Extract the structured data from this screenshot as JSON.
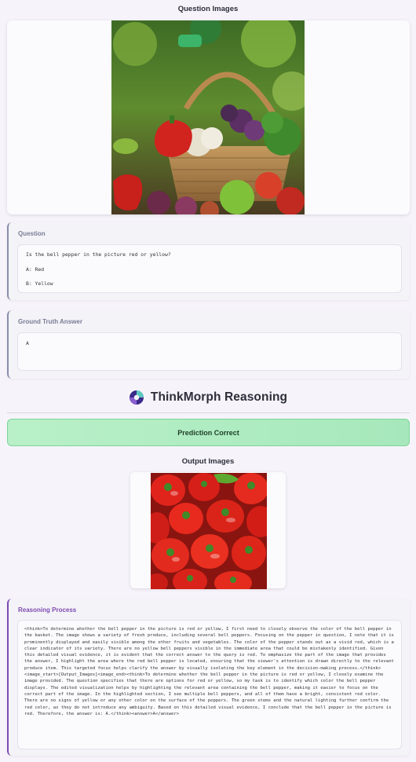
{
  "question_images": {
    "title": "Question Images"
  },
  "question": {
    "label": "Question",
    "text": "Is the bell pepper in the picture red or yellow?",
    "option_a": "A: Red",
    "option_b": "B: Yellow"
  },
  "ground_truth": {
    "label": "Ground Truth Answer",
    "value": "A"
  },
  "brand": {
    "name": "ThinkMorph Reasoning"
  },
  "prediction": {
    "label": "Prediction Correct",
    "color": "#b9f0c8"
  },
  "output_images": {
    "title": "Output Images"
  },
  "reasoning": {
    "label": "Reasoning Process",
    "text": "<think>To determine whether the bell pepper in the picture is red or yellow, I first need to closely observe the color of the bell pepper in the basket. The image shows a variety of fresh produce, including several bell peppers. Focusing on the pepper in question, I note that it is prominently displayed and easily visible among the other fruits and vegetables. The color of the pepper stands out as a vivid red, which is a clear indicator of its variety. There are no yellow bell peppers visible in the immediate area that could be mistakenly identified. Given this detailed visual evidence, it is evident that the correct answer to the query is red. To emphasize the part of the image that provides the answer, I highlight the area where the red bell pepper is located, ensuring that the viewer's attention is drawn directly to the relevant produce item. This targeted focus helps clarify the answer by visually isolating the key element in the decision-making process.</think><image_start>[Output_Images]<image_end><think>To determine whether the bell pepper in the picture is red or yellow, I closely examine the image provided. The question specifies that there are options for red or yellow, so my task is to identify which color the bell pepper displays. The edited visualization helps by highlighting the relevant area containing the bell pepper, making it easier to focus on the correct part of the image. In the highlighted section, I see multiple bell peppers, and all of them have a bright, consistent red color. There are no signs of yellow or any other color on the surface of the peppers. The green stems and the natural lighting further confirm the red color, as they do not introduce any ambiguity. Based on this detailed visual evidence, I conclude that the bell pepper in the picture is red. Therefore, the answer is: A.</think><answer>A</answer>"
  },
  "colors": {
    "accent": "#7d4bb0",
    "panel_border": "#8a8ea8",
    "success_border": "#7fd39a"
  }
}
